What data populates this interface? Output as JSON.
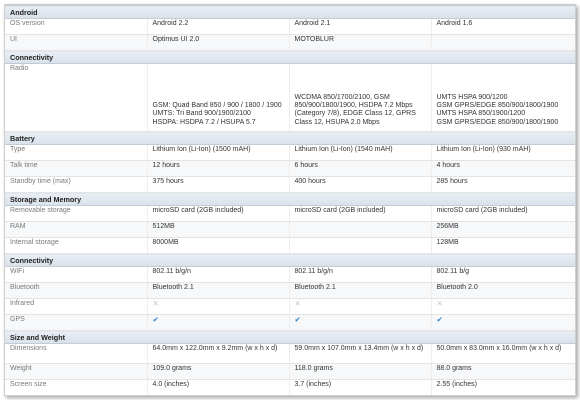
{
  "android": {
    "title": "Android",
    "os_version": {
      "label": "OS version",
      "v1": "Android 2.2",
      "v2": "Android 2.1",
      "v3": "Android 1.6"
    },
    "ui": {
      "label": "UI",
      "v1": "Optimus UI 2.0",
      "v2": "MOTOBLUR",
      "v3": ""
    }
  },
  "connectivity1": {
    "title": "Connectivity",
    "radio": {
      "label": "Radio",
      "v1": "GSM: Quad Band 850 / 900 / 1800 / 1900\nUMTS: Tri Band 900/1900/2100\nHSDPA: HSDPA 7.2 / HSUPA 5.7",
      "v2": "WCDMA 850/1700/2100, GSM 850/900/1800/1900, HSDPA 7.2 Mbps (Category 7/8), EDGE Class 12, GPRS Class 12, HSUPA 2.0 Mbps",
      "v3": "UMTS HSPA 900/1200\nGSM GPRS/EDGE 850/900/1800/1900\nUMTS HSPA 850/1900/1200\nGSM GPRS/EDGE 850/900/1800/1900"
    }
  },
  "battery": {
    "title": "Battery",
    "type": {
      "label": "Type",
      "v1": "Lithium Ion (Li-Ion) (1500 mAH)",
      "v2": "Lithium Ion (Li-Ion) (1540 mAH)",
      "v3": "Lithium Ion (Li-Ion) (930 mAH)"
    },
    "talk": {
      "label": "Talk time",
      "v1": "12 hours",
      "v2": "6 hours",
      "v3": "4 hours"
    },
    "standby": {
      "label": "Standby time (max)",
      "v1": "375 hours",
      "v2": "400 hours",
      "v3": "285 hours"
    }
  },
  "storage": {
    "title": "Storage and Memory",
    "removable": {
      "label": "Removable storage",
      "v1": "microSD card (2GB included)",
      "v2": "microSD card (2GB included)",
      "v3": "microSD card (2GB included)"
    },
    "ram": {
      "label": "RAM",
      "v1": "512MB",
      "v2": "",
      "v3": "256MB"
    },
    "internal": {
      "label": "Internal storage",
      "v1": "8000MB",
      "v2": "",
      "v3": "128MB"
    }
  },
  "connectivity2": {
    "title": "Connectivity",
    "wifi": {
      "label": "WiFi",
      "v1": "802.11 b/g/n",
      "v2": "802.11 b/g/n",
      "v3": "802.11 b/g"
    },
    "bluetooth": {
      "label": "Bluetooth",
      "v1": "Bluetooth 2.1",
      "v2": "Bluetooth 2.1",
      "v3": "Bluetooth 2.0"
    },
    "infrared": {
      "label": "Infrared",
      "v1": "✕",
      "v2": "✕",
      "v3": "✕"
    },
    "gps": {
      "label": "GPS",
      "v1": "✔",
      "v2": "✔",
      "v3": "✔"
    }
  },
  "size": {
    "title": "Size and Weight",
    "dimensions": {
      "label": "Dimensions",
      "v1": "64.0mm x 122.0mm x 9.2mm (w x h x d)",
      "v2": "59.0mm x 107.0mm x 13.4mm (w x h x d)",
      "v3": "50.0mm x 83.0mm x 16.0mm (w x h x d)"
    },
    "weight": {
      "label": "Weight",
      "v1": "109.0 grams",
      "v2": "118.0 grams",
      "v3": "88.0 grams"
    },
    "screen": {
      "label": "Screen size",
      "v1": "4.0 (inches)",
      "v2": "3.7 (inches)",
      "v3": "2.55 (inches)"
    }
  },
  "colors": {
    "check": "#2a7fd4",
    "cross": "#c6c6c6",
    "section_bg": "#dfe6ee"
  }
}
